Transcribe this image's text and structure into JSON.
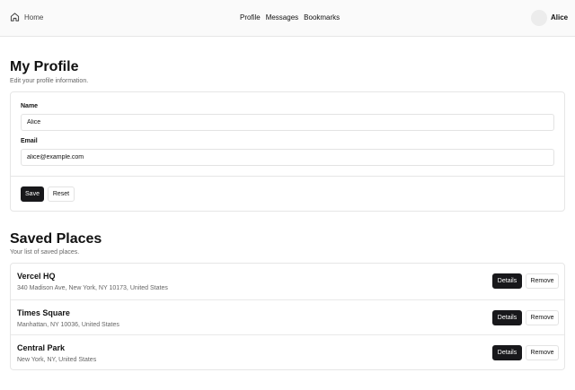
{
  "header": {
    "home_label": "Home",
    "nav": [
      "Profile",
      "Messages",
      "Bookmarks"
    ],
    "user_name": "Alice"
  },
  "profile": {
    "title": "My Profile",
    "subtitle": "Edit your profile information.",
    "name_label": "Name",
    "name_value": "Alice",
    "email_label": "Email",
    "email_value": "alice@example.com",
    "save_label": "Save",
    "reset_label": "Reset"
  },
  "places": {
    "title": "Saved Places",
    "subtitle": "Your list of saved places.",
    "details_label": "Details",
    "remove_label": "Remove",
    "items": [
      {
        "name": "Vercel HQ",
        "address": "340 Madison Ave, New York, NY 10173, United States"
      },
      {
        "name": "Times Square",
        "address": "Manhattan, NY 10036, United States"
      },
      {
        "name": "Central Park",
        "address": "New York, NY, United States"
      }
    ]
  }
}
